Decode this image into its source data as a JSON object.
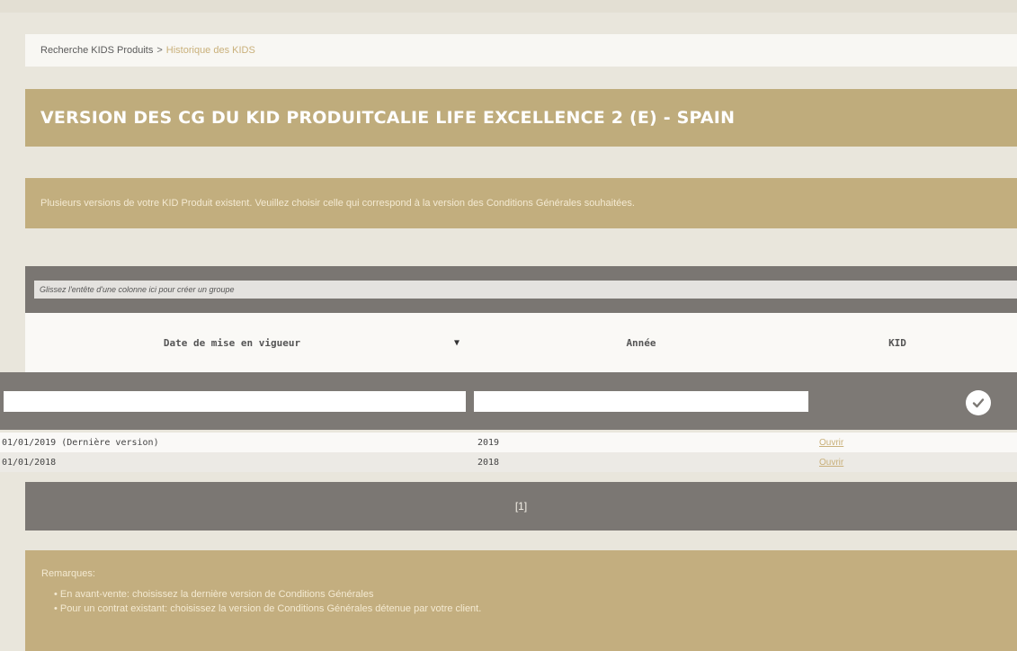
{
  "breadcrumb": {
    "root": "Recherche KIDS Produits",
    "separator": ">",
    "current": "Historique des KIDS"
  },
  "page_title": "VERSION DES CG DU KID PRODUITCALIE LIFE EXCELLENCE 2 (E) - SPAIN",
  "info_message": "Plusieurs versions de votre KID Produit existent. Veuillez choisir celle qui correspond à la version des Conditions Générales souhaitées.",
  "grid": {
    "group_panel_hint": "Glissez l'entête d'une colonne ici pour créer un groupe",
    "columns": [
      "Date de mise en vigueur",
      "Année",
      "KID"
    ],
    "sort_icon": "sort-down-icon",
    "filter_values": [
      "",
      ""
    ],
    "rows": [
      {
        "date": "01/01/2019 (Dernière version)",
        "annee": "2019",
        "kid": "Ouvrir"
      },
      {
        "date": "01/01/2018",
        "annee": "2018",
        "kid": "Ouvrir"
      }
    ],
    "pager": "[1]"
  },
  "remarks": {
    "title": "Remarques:",
    "items": [
      "En avant-vente: choisissez la dernière version de Conditions Générales",
      "Pour un contrat existant: choisissez la version de Conditions Générales détenue par votre client."
    ]
  },
  "colors": {
    "accent": "#bfac7c",
    "grid_dark": "#7b7773",
    "link": "#c9b07a"
  }
}
